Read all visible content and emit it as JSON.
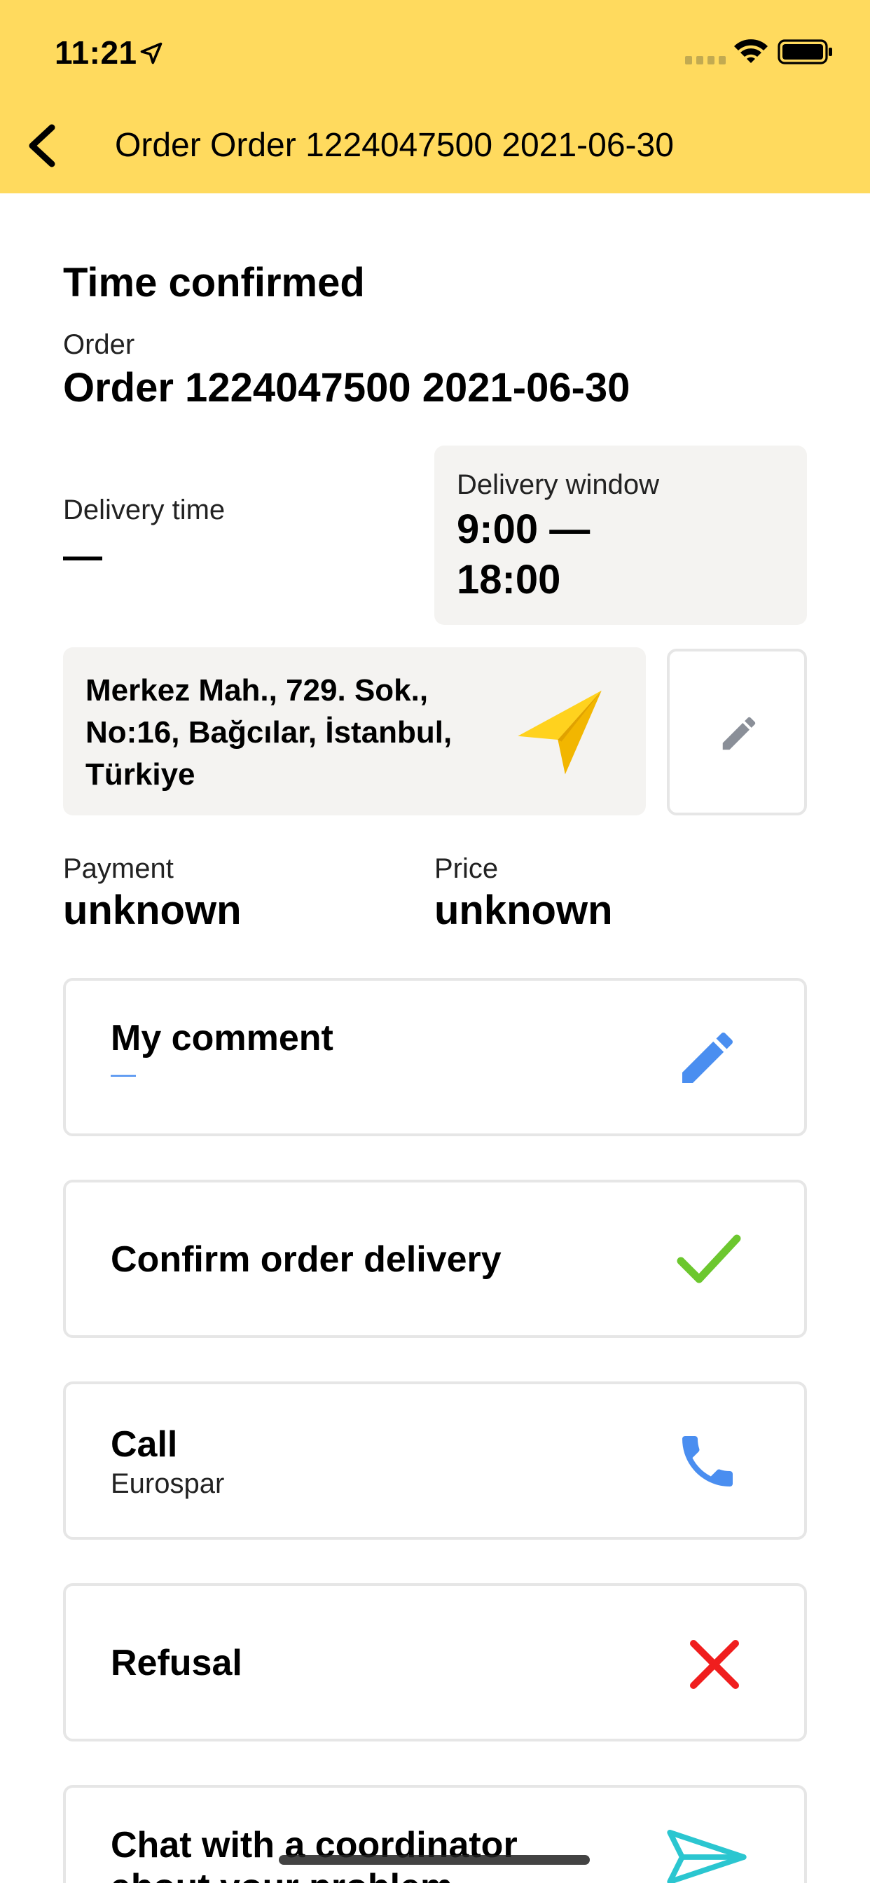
{
  "status_bar": {
    "time": "11:21"
  },
  "nav": {
    "title": "Order Order 1224047500 2021-06-30"
  },
  "status": "Time confirmed",
  "order": {
    "label": "Order",
    "value": "Order 1224047500 2021-06-30"
  },
  "delivery_time": {
    "label": "Delivery time",
    "value": "—"
  },
  "delivery_window": {
    "label": "Delivery window",
    "value": "9:00 — 18:00"
  },
  "address": {
    "text": "Merkez Mah., 729. Sok., No:16, Bağcılar, İstanbul, Türkiye"
  },
  "payment": {
    "label": "Payment",
    "value": "unknown"
  },
  "price": {
    "label": "Price",
    "value": "unknown"
  },
  "cards": {
    "comment": {
      "title": "My comment",
      "subtitle": "—"
    },
    "confirm": {
      "title": "Confirm order delivery"
    },
    "call": {
      "title": "Call",
      "subtitle": "Eurospar"
    },
    "refusal": {
      "title": "Refusal"
    },
    "chat": {
      "title": "Chat with a coordinator about your problem"
    }
  },
  "colors": {
    "header": "#FFDA5E",
    "accent_blue": "#4A8EF0",
    "check_green": "#6CC72E",
    "refusal_red": "#F01E1E",
    "chat_teal": "#2BC6D0"
  }
}
